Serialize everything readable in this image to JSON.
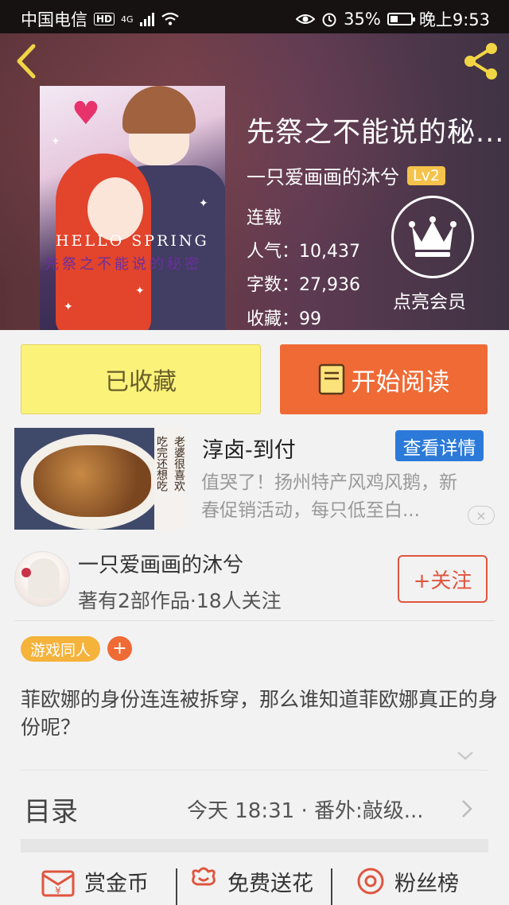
{
  "statusbar": {
    "carrier": "中国电信",
    "hd": "HD",
    "network": "4G",
    "battery": "35%",
    "time": "晚上9:53"
  },
  "book": {
    "title": "先祭之不能说的秘...",
    "author": "一只爱画画的沐兮",
    "level": "Lv2",
    "status": "连载",
    "popularity_label": "人气：",
    "popularity": "10,437",
    "words_label": "字数：",
    "words": "27,936",
    "favorites_label": "收藏：",
    "favorites": "99",
    "vip_label": "点亮会员",
    "cover_caption": "HELLO SPRING",
    "cover_subcaption": "先祭之不能说的秘密"
  },
  "buttons": {
    "collected": "已收藏",
    "start_reading": "开始阅读"
  },
  "ad": {
    "title": "淳卤-到付",
    "details_button": "查看详情",
    "description": "值哭了！扬州特产风鸡风鹅，新春促销活动，每只低至白...",
    "image_tag_lines": [
      "吃完还想吃",
      "老婆很喜欢"
    ],
    "close": "×"
  },
  "author_card": {
    "name": "一只爱画画的沐兮",
    "meta": "著有2部作品·18人关注",
    "follow": "+关注"
  },
  "tags": {
    "chip": "游戏同人",
    "add": "+"
  },
  "summary": "菲欧娜的身份连连被拆穿，那么谁知道菲欧娜真正的身份呢？",
  "toc": {
    "label": "目录",
    "latest": "今天 18:31 · 番外:敲级..."
  },
  "actions": [
    {
      "label": "赏金币",
      "icon": "gold-coin-envelope-icon"
    },
    {
      "label": "免费送花",
      "icon": "flower-icon"
    },
    {
      "label": "粉丝榜",
      "icon": "ranking-medal-icon"
    }
  ],
  "colors": {
    "orange": "#ef6a35",
    "yellow_button": "#fbf27a",
    "blue_button": "#2b7ad9",
    "tag_orange": "#f5b33b",
    "follow_red": "#e0553f"
  }
}
